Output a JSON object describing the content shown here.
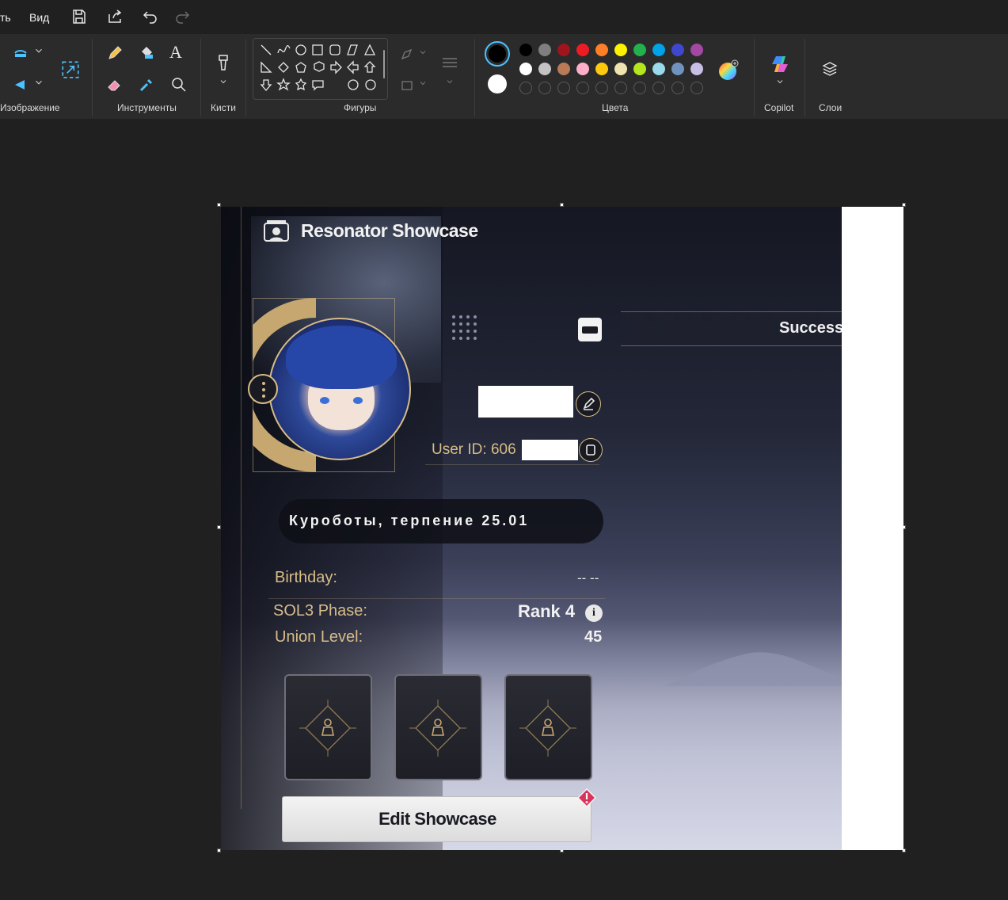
{
  "menubar": {
    "file_partial": "ть",
    "view": "Вид"
  },
  "ribbon": {
    "groups": {
      "image": "Изображение",
      "tools": "Инструменты",
      "brushes": "Кисти",
      "shapes": "Фигуры",
      "colors": "Цвета",
      "copilot": "Copilot",
      "layers": "Слои"
    },
    "palette_row1": [
      "#000000",
      "#7f7f7f",
      "#a0141c",
      "#ed1c24",
      "#ff7f27",
      "#fff200",
      "#22b14c",
      "#00a2e8",
      "#3f48cc",
      "#a349a4"
    ],
    "palette_row2": [
      "#ffffff",
      "#c3c3c3",
      "#b97a57",
      "#ffaec9",
      "#ffc90e",
      "#efe4b0",
      "#b5e61d",
      "#99d9ea",
      "#7092be",
      "#c8bfe7"
    ],
    "primary_color": "#000000",
    "secondary_color": "#ffffff"
  },
  "game": {
    "title": "Resonator Showcase",
    "success": "Success",
    "user_id": "User ID: 606",
    "signature": "Куроботы, терпение 25.01",
    "stats": [
      {
        "label": "Birthday:",
        "value": "-- --"
      },
      {
        "label": "SOL3 Phase:",
        "value": "Rank 4"
      },
      {
        "label": "Union Level:",
        "value": "45"
      }
    ],
    "edit_button": "Edit Showcase",
    "accent_gold": "#d7bd87"
  }
}
